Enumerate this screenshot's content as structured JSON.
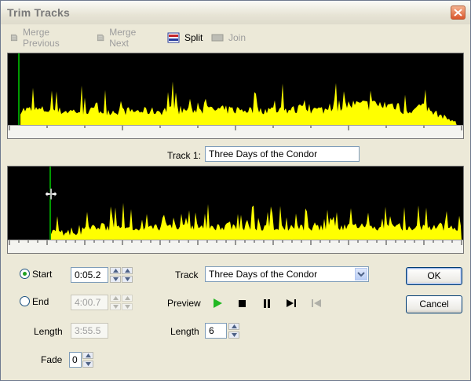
{
  "window": {
    "title": "Trim Tracks"
  },
  "toolbar": {
    "merge_previous": "Merge Previous",
    "merge_next": "Merge Next",
    "split": "Split",
    "join": "Join"
  },
  "track_label": "Track 1:",
  "track_name_value": "Three Days of the Condor",
  "controls": {
    "start_label": "Start",
    "start_value": "0:05.2",
    "end_label": "End",
    "end_value": "4:00.7",
    "length_label": "Length",
    "length_value": "3:55.5",
    "fade_label": "Fade",
    "fade_value": "0",
    "track_label": "Track",
    "track_selected": "Three Days of the Condor",
    "preview_label": "Preview",
    "track_length_label": "Length",
    "track_length_value": "6"
  },
  "buttons": {
    "ok": "OK",
    "cancel": "Cancel"
  },
  "colors": {
    "waveform": "#ffff00",
    "marker": "#00cc00",
    "background": "#ece9d8"
  },
  "icons": [
    "merge-previous-icon",
    "merge-next-icon",
    "split-icon",
    "join-icon",
    "close-icon",
    "play-icon",
    "stop-icon",
    "pause-icon",
    "next-icon",
    "previous-icon",
    "resize-cursor-icon"
  ]
}
